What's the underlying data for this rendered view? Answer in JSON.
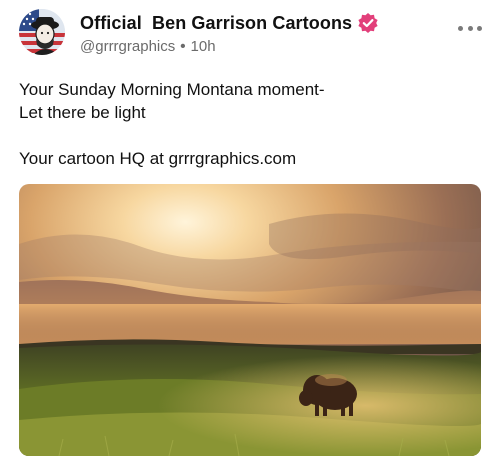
{
  "post": {
    "display_name": "Official  Ben Garrison Cartoons",
    "handle": "@grrrgraphics",
    "time": "10h",
    "separator": "•",
    "text_lines": [
      "Your Sunday Morning Montana moment-",
      "Let there be light",
      "",
      "Your cartoon HQ at grrrgraphics.com"
    ]
  },
  "icons": {
    "verified": "verified-badge-icon",
    "more": "more-options-icon"
  },
  "colors": {
    "verified_badge": "#e23f7a",
    "handle_text": "#6b6b6b",
    "sky_glow": "#f3c98c",
    "grass": "#5b6a24"
  }
}
